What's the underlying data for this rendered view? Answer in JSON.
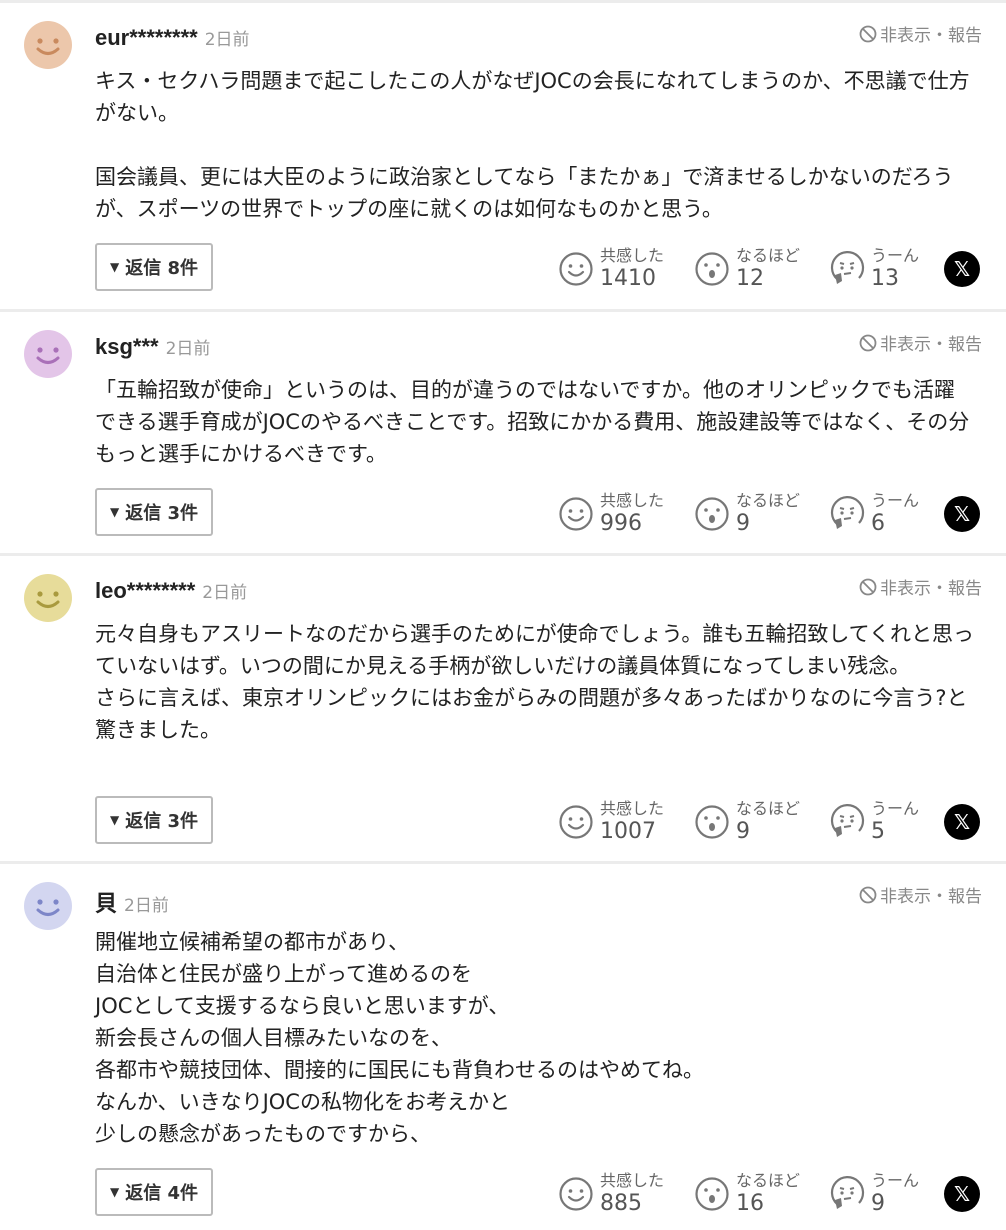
{
  "hide_report_label": "非表示・報告",
  "reaction_labels": {
    "empathy": "共感した",
    "indeed": "なるほど",
    "hmm": "うーん"
  },
  "x_share_glyph": "𝕏",
  "icons": {
    "avatar": "smiley-face-icon",
    "hide": "ban-icon",
    "empathy": "smile-icon",
    "indeed": "surprised-face-icon",
    "hmm": "thinking-face-icon",
    "share": "x-logo-icon",
    "reply_toggle": "triangle-down-icon"
  },
  "comments": [
    {
      "avatar_color": "#ecc7ab",
      "avatar_face_color": "#c98a5e",
      "username": "eur********",
      "time": "2日前",
      "body": "キス・セクハラ問題まで起こしたこの人がなぜJOCの会長になれてしまうのか、不思議で仕方がない。\n\n国会議員、更には大臣のように政治家としてなら「またかぁ」で済ませるしかないのだろうが、スポーツの世界でトップの座に就くのは如何なものかと思う。",
      "reply_label": "返信 8件",
      "empathy": "1410",
      "indeed": "12",
      "hmm": "13"
    },
    {
      "avatar_color": "#e3c5e8",
      "avatar_face_color": "#a970b8",
      "username": "ksg***",
      "time": "2日前",
      "body": "「五輪招致が使命」というのは、目的が違うのではないですか。他のオリンピックでも活躍できる選手育成がJOCのやるべきことです。招致にかかる費用、施設建設等ではなく、その分もっと選手にかけるべきです。",
      "reply_label": "返信 3件",
      "empathy": "996",
      "indeed": "9",
      "hmm": "6"
    },
    {
      "avatar_color": "#e7dc9a",
      "avatar_face_color": "#a99a3e",
      "username": "leo********",
      "time": "2日前",
      "body": "元々自身もアスリートなのだから選手のためにが使命でしょう。誰も五輪招致してくれと思っていないはず。いつの間にか見える手柄が欲しいだけの議員体質になってしまい残念。\nさらに言えば、東京オリンピックにはお金がらみの問題が多々あったばかりなのに今言う?と驚きました。",
      "reply_label": "返信 3件",
      "empathy": "1007",
      "indeed": "9",
      "hmm": "5"
    },
    {
      "avatar_color": "#d3d6f0",
      "avatar_face_color": "#7d86c8",
      "username": "貝",
      "time": "2日前",
      "body": "開催地立候補希望の都市があり、\n自治体と住民が盛り上がって進めるのを\nJOCとして支援するなら良いと思いますが、\n新会長さんの個人目標みたいなのを、\n各都市や競技団体、間接的に国民にも背負わせるのはやめてね。\nなんか、いきなりJOCの私物化をお考えかと\n少しの懸念があったものですから、",
      "reply_label": "返信 4件",
      "empathy": "885",
      "indeed": "16",
      "hmm": "9"
    }
  ]
}
